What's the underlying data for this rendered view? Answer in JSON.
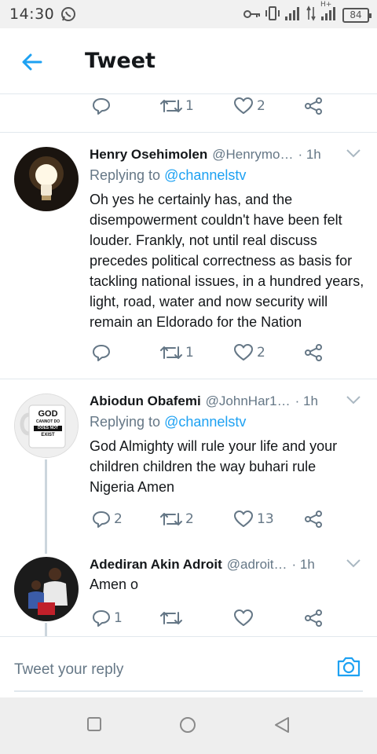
{
  "status_bar": {
    "time": "14:30",
    "battery": "84",
    "network_label": "H+"
  },
  "header": {
    "title": "Tweet"
  },
  "top_actions": {
    "retweet_count": "1",
    "like_count": "2"
  },
  "tweets": [
    {
      "name": "Henry Osehimolen",
      "handle": "@Henrymo…",
      "time": "· 1h",
      "replying_prefix": "Replying to ",
      "replying_to": "@channelstv",
      "text": "Oh yes he certainly has, and the disempowerment couldn't have been felt louder. Frankly, not until real discuss precedes political correctness as basis for tackling national issues, in a hundred years, light, road, water and now security will remain an Eldorado for the Nation",
      "reply_count": "",
      "retweet_count": "1",
      "like_count": "2"
    },
    {
      "name": "Abiodun Obafemi",
      "handle": "@JohnHar1…",
      "time": "· 1h",
      "replying_prefix": "Replying to ",
      "replying_to": "@channelstv",
      "text": "God Almighty will rule your life and your children children the way buhari rule Nigeria  Amen",
      "reply_count": "2",
      "retweet_count": "2",
      "like_count": "13",
      "avatar_text": [
        "GOD",
        "CANNOT DO",
        "DOES NOT",
        "EXIST"
      ]
    },
    {
      "name": "Adediran Akin Adroit",
      "handle": "@adroit…",
      "time": "· 1h",
      "text": "Amen o",
      "reply_count": "1",
      "retweet_count": "",
      "like_count": ""
    }
  ],
  "composer": {
    "placeholder": "Tweet your reply"
  },
  "colors": {
    "accent": "#1da1f2",
    "muted": "#657786",
    "divider": "#e1e8ed"
  }
}
